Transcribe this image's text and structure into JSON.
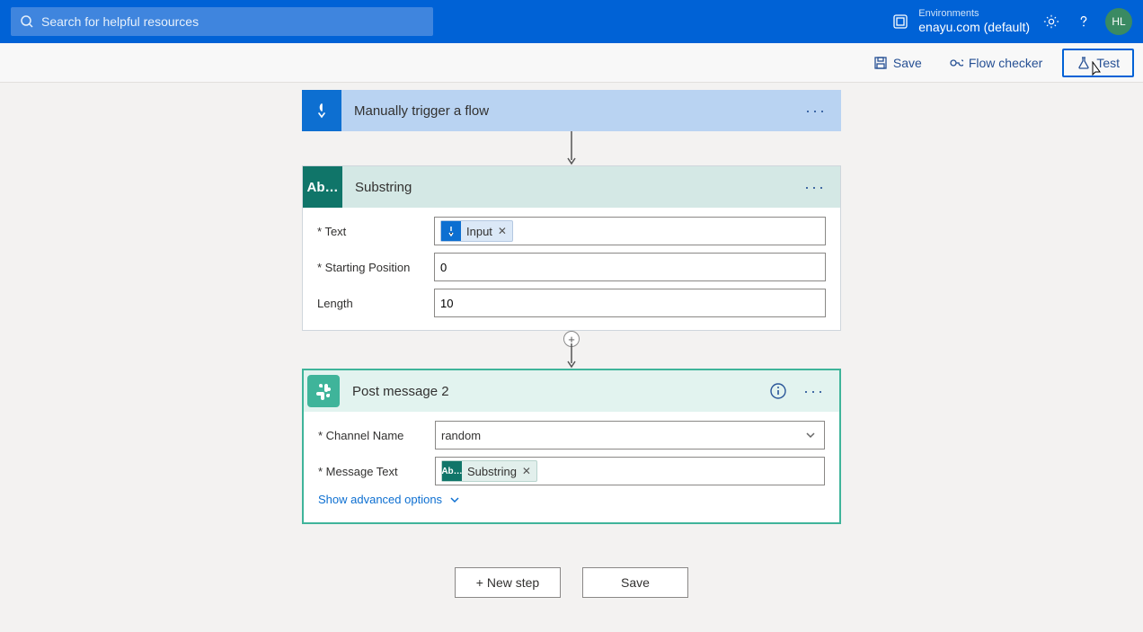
{
  "topbar": {
    "search_placeholder": "Search for helpful resources",
    "env_label": "Environments",
    "env_name": "enayu.com (default)",
    "avatar_initials": "HL"
  },
  "toolbar": {
    "save_label": "Save",
    "flow_checker_label": "Flow checker",
    "test_label": "Test"
  },
  "trigger": {
    "title": "Manually trigger a flow"
  },
  "substring": {
    "title": "Substring",
    "icon_text": "Ab…",
    "rows": {
      "text_label": "Text",
      "text_token": "Input",
      "start_label": "Starting Position",
      "start_value": "0",
      "length_label": "Length",
      "length_value": "10"
    }
  },
  "slack": {
    "title": "Post message 2",
    "rows": {
      "channel_label": "Channel Name",
      "channel_value": "random",
      "message_label": "Message Text",
      "message_token": "Substring",
      "message_token_icon": "Ab…"
    },
    "advanced_label": "Show advanced options"
  },
  "bottom": {
    "new_step_label": "+ New step",
    "save_label": "Save"
  }
}
